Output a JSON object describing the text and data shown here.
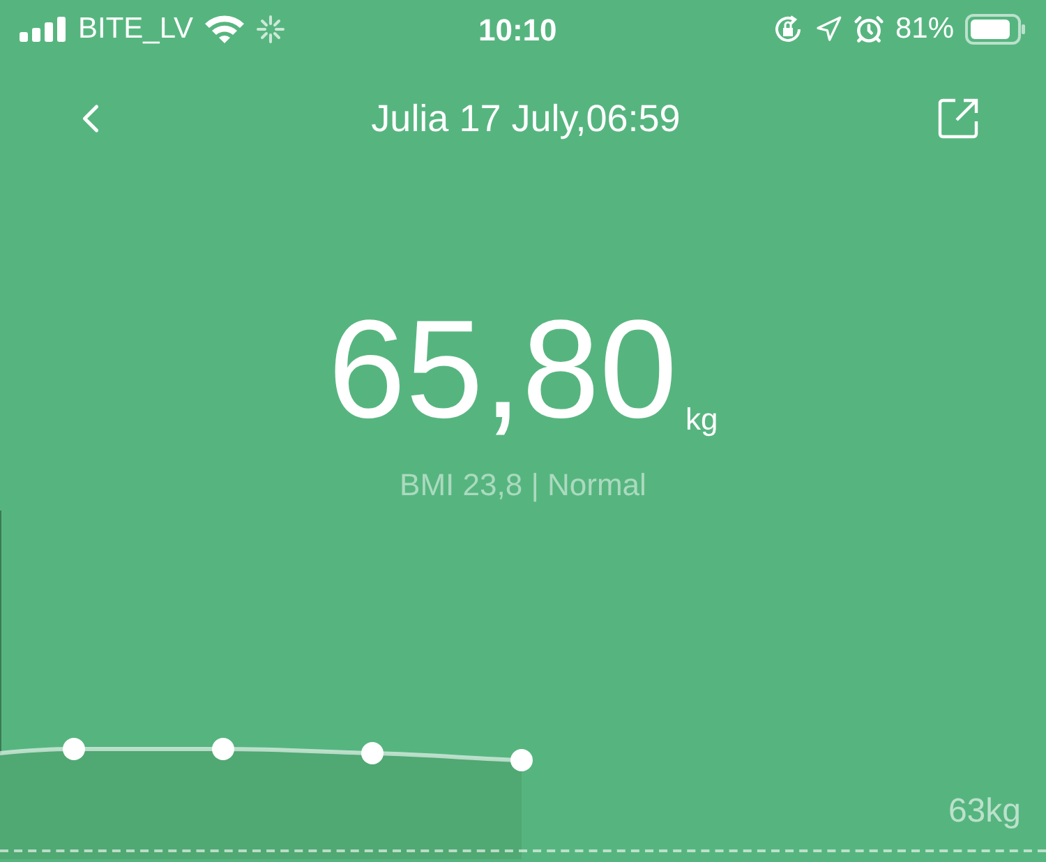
{
  "status_bar": {
    "carrier": "BITE_LV",
    "time": "10:10",
    "battery": "81%"
  },
  "nav": {
    "title": "Julia 17 July,06:59"
  },
  "measurement": {
    "value": "65,80",
    "unit": "kg",
    "bmi": "BMI 23,8 | Normal"
  },
  "trend": {
    "axis_label": "63kg"
  }
}
